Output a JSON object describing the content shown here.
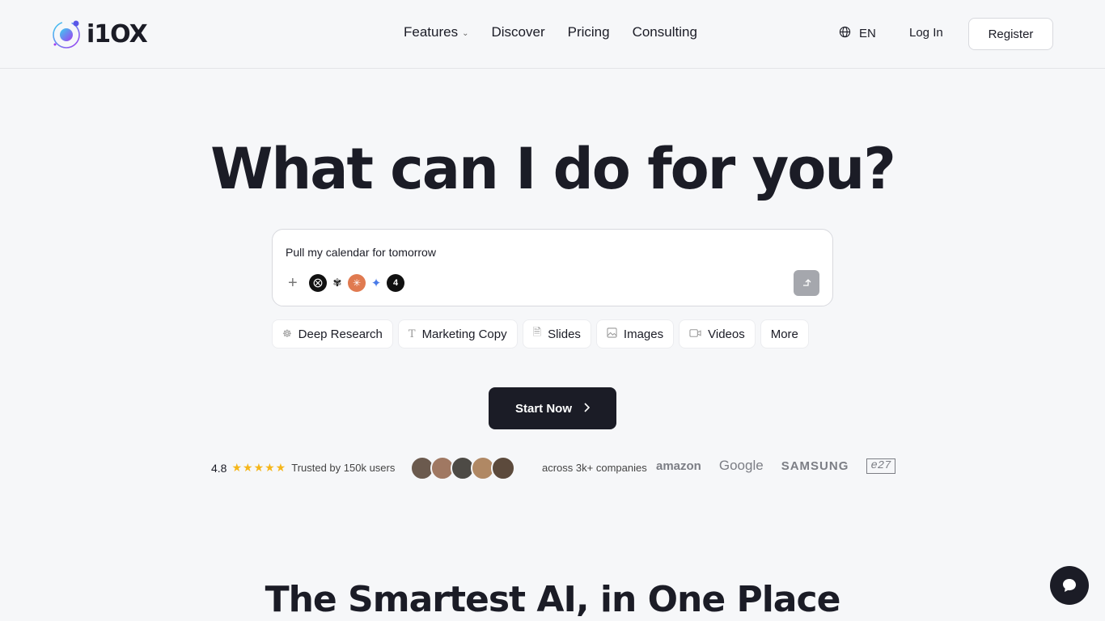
{
  "header": {
    "logo_text": "i1OX",
    "nav": [
      {
        "label": "Features",
        "has_dropdown": true
      },
      {
        "label": "Discover"
      },
      {
        "label": "Pricing"
      },
      {
        "label": "Consulting"
      }
    ],
    "language": "EN",
    "login_label": "Log In",
    "register_label": "Register"
  },
  "hero": {
    "title": "What can I do for you?",
    "prompt_value": "Pull my calendar for tomorrow",
    "models": [
      "chatgpt-icon",
      "mistral-icon",
      "claude-icon",
      "gemini-icon",
      "perplexity-icon"
    ],
    "chips": [
      {
        "label": "Deep Research",
        "icon": "brain-icon"
      },
      {
        "label": "Marketing Copy",
        "icon": "text-icon"
      },
      {
        "label": "Slides",
        "icon": "document-icon"
      },
      {
        "label": "Images",
        "icon": "image-icon"
      },
      {
        "label": "Videos",
        "icon": "video-icon"
      },
      {
        "label": "More",
        "icon": ""
      }
    ],
    "start_label": "Start Now"
  },
  "social_proof": {
    "rating": "4.8",
    "stars": 5,
    "trusted_text": "Trusted by 150k users",
    "companies_text": "across 3k+ companies",
    "brands": [
      "amazon",
      "Google",
      "SAMSUNG",
      "e27"
    ]
  },
  "section": {
    "title": "The Smartest AI, in One Place"
  },
  "colors": {
    "primary_dark": "#1b1c26",
    "background": "#f6f7f9",
    "star": "#f5b61a"
  }
}
